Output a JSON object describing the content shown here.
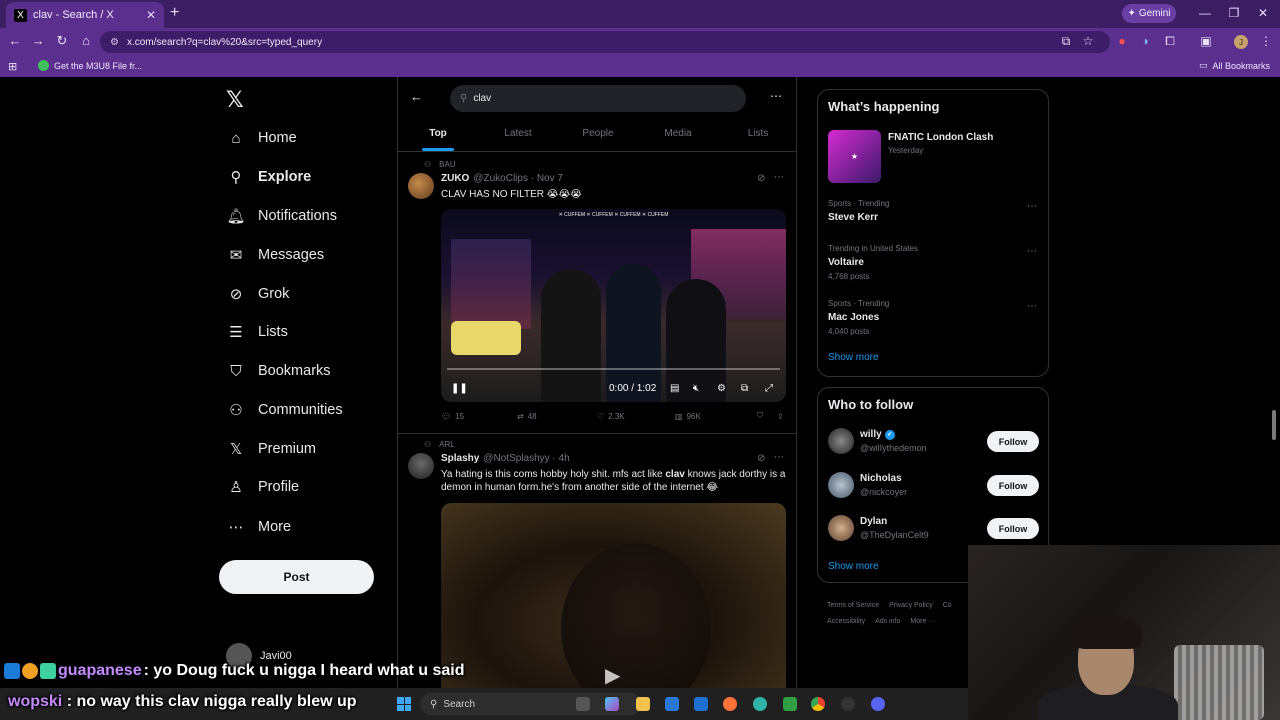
{
  "browser": {
    "tab_title": "clav - Search / X",
    "tab_favicon": "X",
    "close_tab": "✕",
    "new_tab": "+",
    "gemini_label": "Gemini",
    "url": "x.com/search?q=clav%20&src=typed_query",
    "bookmark_item": "Get the M3U8 File fr...",
    "all_bookmarks": "All Bookmarks",
    "profile_initial": "J"
  },
  "nav": {
    "items": [
      {
        "label": "Home",
        "icon": "home-icon",
        "glyph": "⌂"
      },
      {
        "label": "Explore",
        "icon": "search-icon",
        "glyph": "⚲"
      },
      {
        "label": "Notifications",
        "icon": "bell-icon",
        "glyph": "🔔︎"
      },
      {
        "label": "Messages",
        "icon": "envelope-icon",
        "glyph": "✉"
      },
      {
        "label": "Grok",
        "icon": "grok-icon",
        "glyph": "⊘"
      },
      {
        "label": "Lists",
        "icon": "list-icon",
        "glyph": "☰"
      },
      {
        "label": "Bookmarks",
        "icon": "bookmark-icon",
        "glyph": "⛉"
      },
      {
        "label": "Communities",
        "icon": "people-icon",
        "glyph": "⚇"
      },
      {
        "label": "Premium",
        "icon": "x-premium-icon",
        "glyph": "𝕏"
      },
      {
        "label": "Profile",
        "icon": "person-icon",
        "glyph": "♙"
      },
      {
        "label": "More",
        "icon": "more-circle-icon",
        "glyph": "⋯"
      }
    ],
    "post_button": "Post",
    "account_name": "Javi00"
  },
  "search": {
    "query": "clav",
    "tabs": [
      "Top",
      "Latest",
      "People",
      "Media",
      "Lists"
    ],
    "active_tab": "Top"
  },
  "tweets": [
    {
      "context": "BAU",
      "name": "ZUKO",
      "handle": "@ZukoClips · Nov 7",
      "text": "CLAV HAS NO FILTER 😭😭😭",
      "video_time": "0:00 / 1:02",
      "replies": "15",
      "reposts": "48",
      "likes": "2.3K",
      "views": "96K",
      "overlay_text": "✕ CUFFEM ✕ CUFFEM ✕ CUFFEM ✕ CUFFEM"
    },
    {
      "context": "ARL",
      "name": "Splashy",
      "handle": "@NotSplashyy · 4h",
      "text_parts": [
        "Ya hating is this coms hobby holy shit. mfs act like ",
        "clav",
        " knows jack dorthy is a demon in human form.he's from another side of the internet 😂"
      ]
    }
  ],
  "trending": {
    "title": "What’s happening",
    "event_name": "FNATIC London Clash",
    "event_time": "Yesterday",
    "items": [
      {
        "meta": "Sports · Trending",
        "name": "Steve Kerr",
        "posts": ""
      },
      {
        "meta": "Trending in United States",
        "name": "Voltaire",
        "posts": "4,768 posts"
      },
      {
        "meta": "Sports · Trending",
        "name": "Mac Jones",
        "posts": "4,040 posts"
      }
    ],
    "show_more": "Show more"
  },
  "who_to_follow": {
    "title": "Who to follow",
    "accounts": [
      {
        "name": "willy",
        "handle": "@wilIythedemon",
        "verified": true
      },
      {
        "name": "Nicholas",
        "handle": "@nickcoyer",
        "verified": false
      },
      {
        "name": "Dylan",
        "handle": "@TheDylanCelt9",
        "verified": false
      }
    ],
    "follow_label": "Follow",
    "show_more": "Show more"
  },
  "footer": {
    "links": [
      "Terms of Service",
      "Privacy Policy",
      "Co",
      "Accessibility",
      "Ads info",
      "More ···"
    ]
  },
  "stream": {
    "chat1_user": "guapanese",
    "chat1_text": ": yo Doug fuck u nigga I heard what u said",
    "chat2_user": "wopski",
    "chat2_text": ": no way this clav nigga really blew up",
    "taskbar_search": "Search"
  },
  "colors": {
    "accent": "#1d9bf0",
    "browser_frame": "#5b2f8e",
    "chat_username": "#c38bff"
  }
}
